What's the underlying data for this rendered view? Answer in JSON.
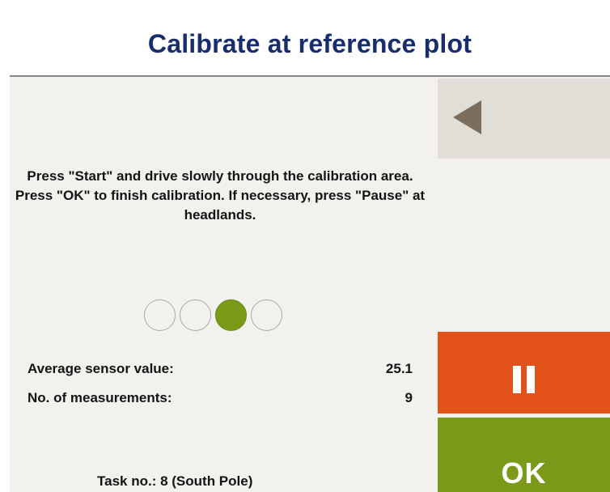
{
  "header": {
    "title": "Calibrate at reference plot"
  },
  "instructions": {
    "text": "Press \"Start\" and drive slowly through the calibration area. Press \"OK\" to finish calibration. If necessary, press \"Pause\" at headlands."
  },
  "progress": {
    "total_steps": 4,
    "active_step": 3
  },
  "stats": {
    "avg_label": "Average sensor value:",
    "avg_value": "25.1",
    "count_label": "No. of measurements:",
    "count_value": "9"
  },
  "buttons": {
    "back_icon": "back-arrow-icon",
    "pause_icon": "pause-icon",
    "ok_label": "OK"
  },
  "footer": {
    "task": "Task no.: 8 (South Pole)"
  },
  "colors": {
    "title": "#1a2d6b",
    "pause": "#e35218",
    "ok": "#7b9a1a",
    "back": "#e1ddd7",
    "active_dot": "#7b9a1a"
  }
}
